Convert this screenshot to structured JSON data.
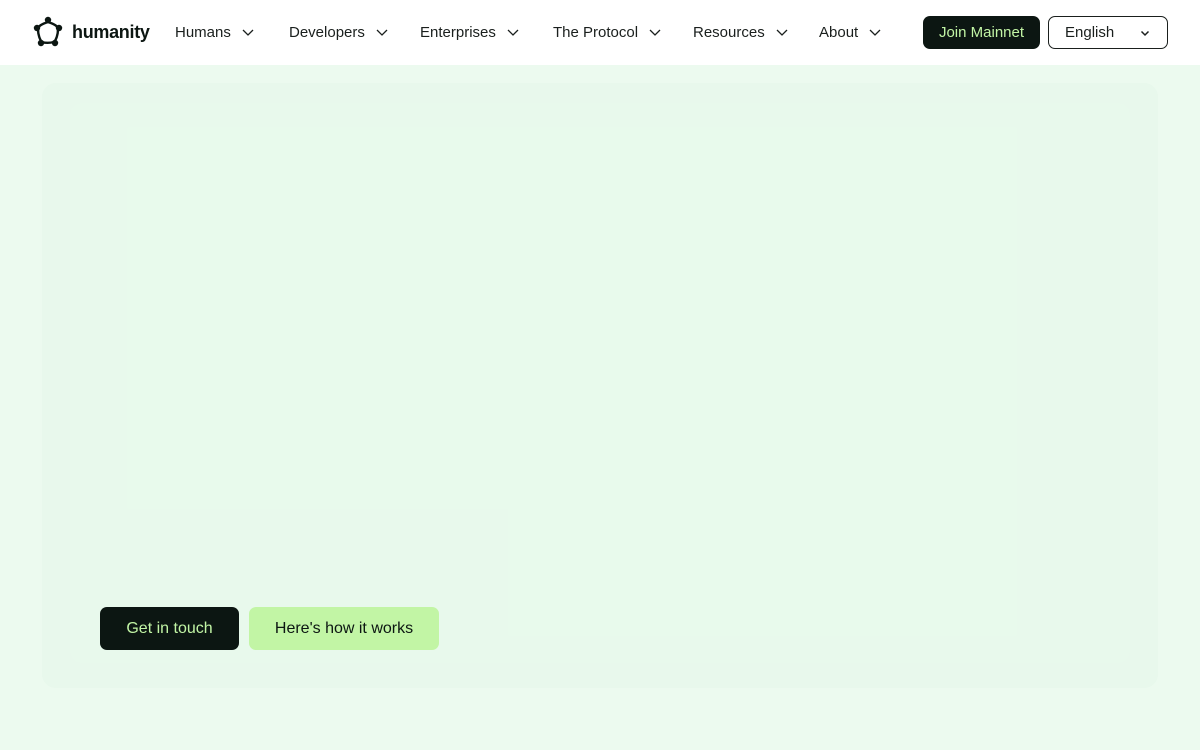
{
  "brand": {
    "name": "humanity",
    "logo_icon": "humanity-logo-icon"
  },
  "nav": {
    "items": [
      {
        "label": "Humans",
        "icon": "chevron-down-icon"
      },
      {
        "label": "Developers",
        "icon": "chevron-down-icon"
      },
      {
        "label": "Enterprises",
        "icon": "chevron-down-icon"
      },
      {
        "label": "The Protocol",
        "icon": "chevron-down-icon"
      },
      {
        "label": "Resources",
        "icon": "chevron-down-icon"
      },
      {
        "label": "About",
        "icon": "chevron-down-icon"
      }
    ],
    "join_label": "Join Mainnet",
    "language": {
      "selected": "English",
      "icon": "chevron-down-icon"
    }
  },
  "hero": {
    "primary_cta": "Get in touch",
    "secondary_cta": "Here's how it works"
  },
  "colors": {
    "accent_green": "#c2f5a5",
    "dark": "#0c1612",
    "hero_background": "#ecfaef",
    "header_background": "#ffffff"
  }
}
